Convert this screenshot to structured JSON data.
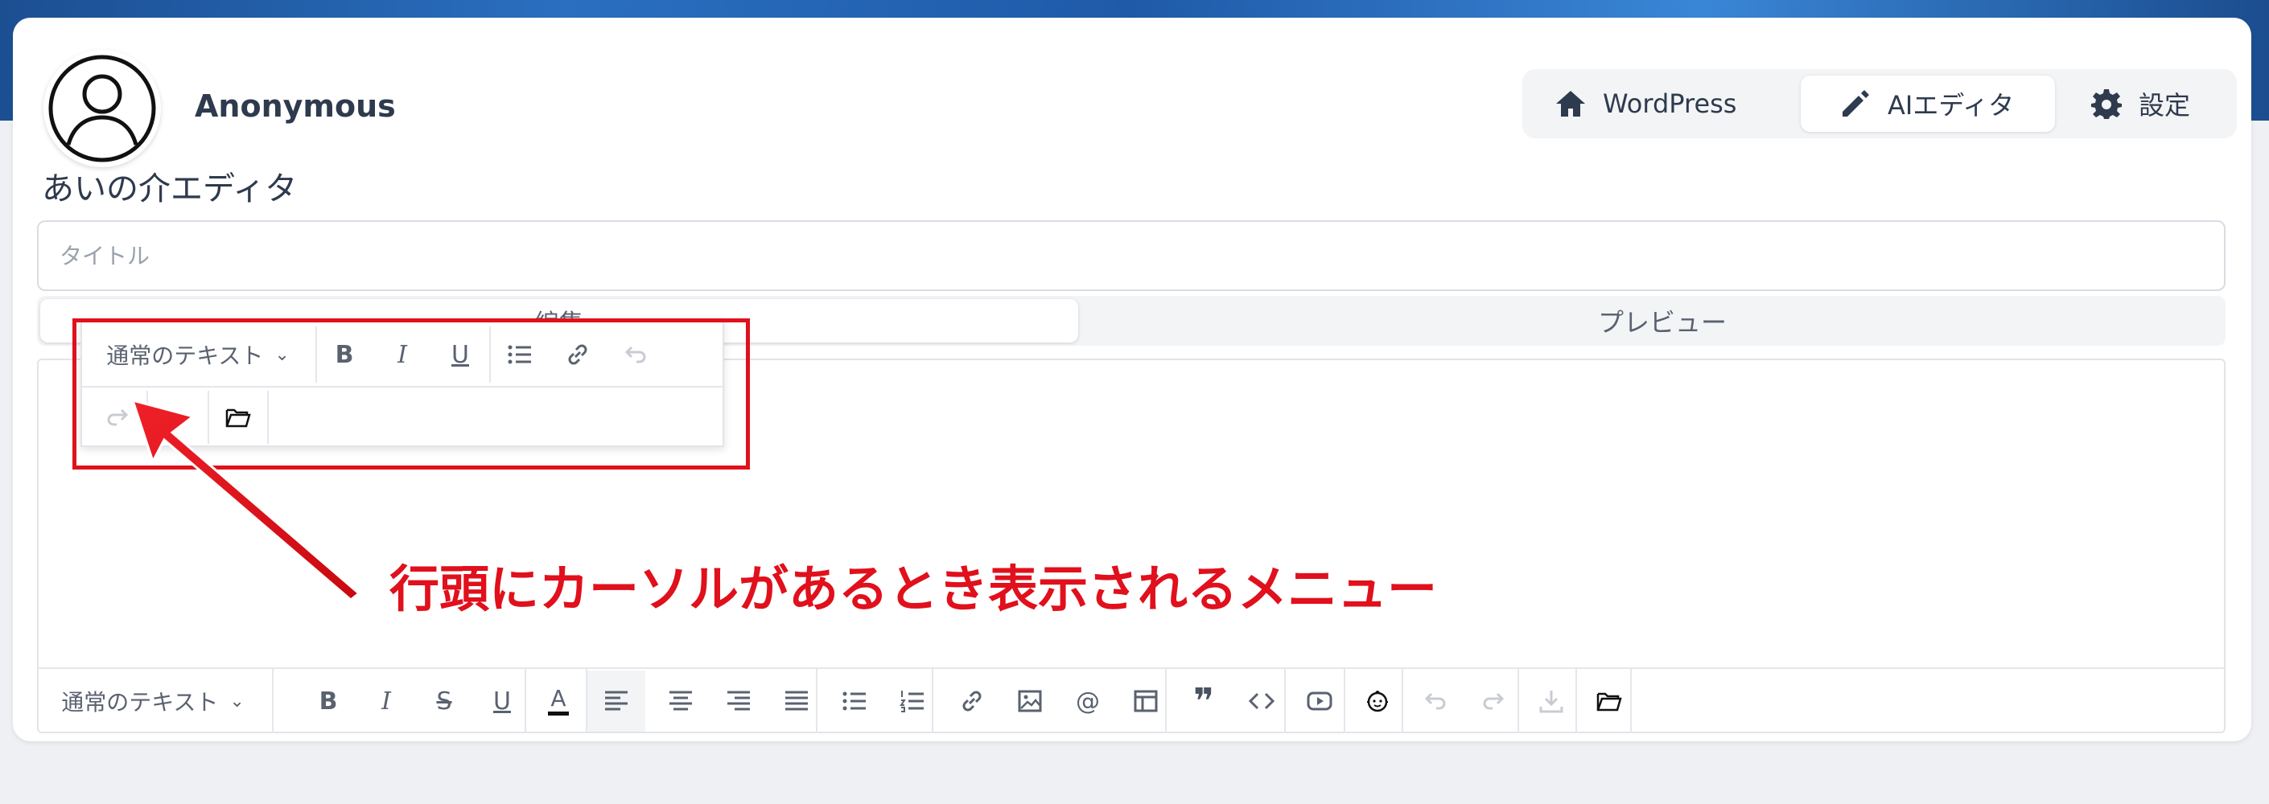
{
  "header": {
    "username": "Anonymous",
    "nav": [
      {
        "label": "WordPress",
        "icon": "home-icon"
      },
      {
        "label": "AIエディタ",
        "icon": "pencil-icon"
      },
      {
        "label": "設定",
        "icon": "gear-icon"
      }
    ]
  },
  "page": {
    "title": "あいの介エディタ"
  },
  "title_field": {
    "placeholder": "タイトル"
  },
  "tabs": [
    {
      "label": "編集"
    },
    {
      "label": "プレビュー"
    }
  ],
  "editor": {
    "placeholder": "",
    "style_select": "通常のテキスト"
  },
  "floating_toolbar": {
    "style_select": "通常のテキスト"
  },
  "annotation": {
    "text": "行頭にカーソルがあるとき表示されるメニュー",
    "color": "#e0101c"
  },
  "colors": {
    "accent": "#e0101c",
    "banner": "#2a6fc0",
    "text": "#2e3a4d"
  }
}
